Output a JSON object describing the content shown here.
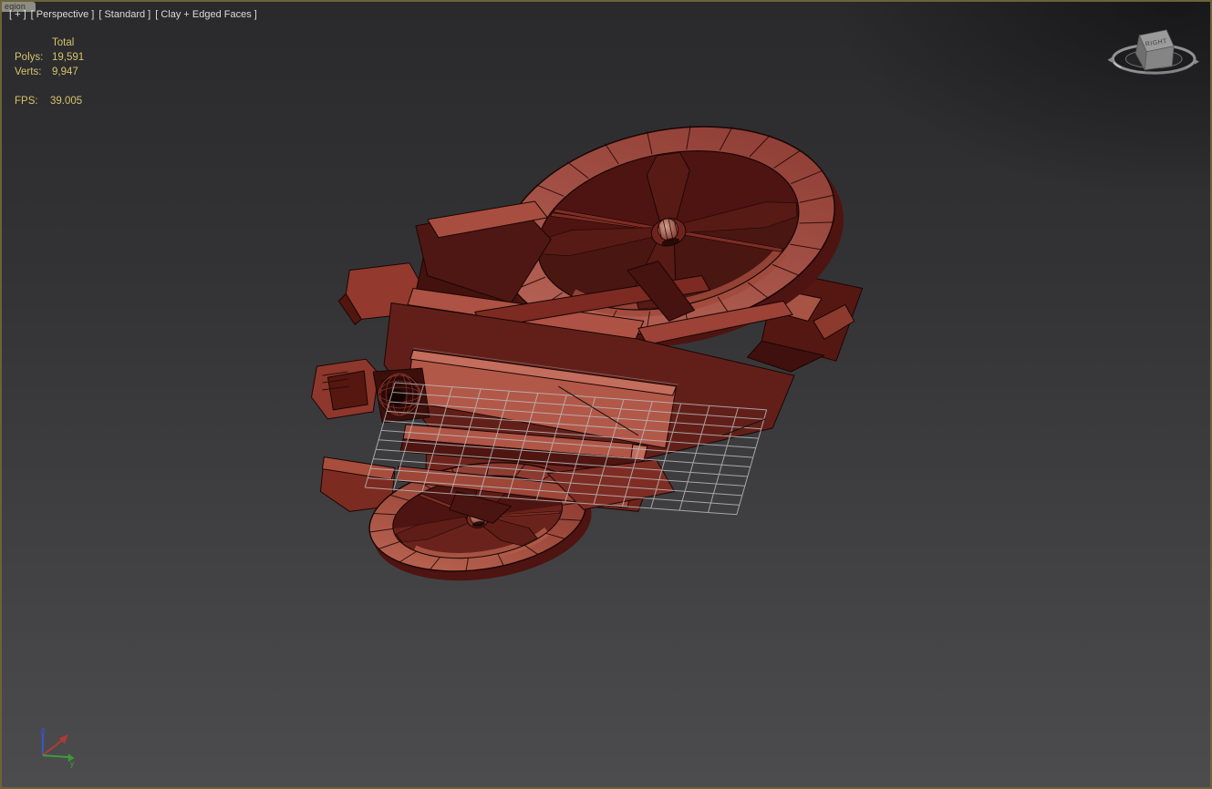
{
  "viewport": {
    "selection_tab_label": "egion",
    "label_menus": {
      "general": "[ + ]",
      "point_of_view": "[ Perspective ]",
      "render_preset": "[ Standard ]",
      "shading": "[ Clay + Edged Faces ]"
    },
    "statistics": {
      "total_header": "Total",
      "polys_label": "Polys:",
      "polys_value": "19,591",
      "verts_label": "Verts:",
      "verts_value": "9,947",
      "fps_label": "FPS:",
      "fps_value": "39.005"
    },
    "viewcube": {
      "face_label": "RIGHT"
    },
    "axis_gizmo": {
      "z_label": "z",
      "y_label": "y"
    }
  },
  "colors": {
    "viewport_bg_top": "#2a2a2c",
    "viewport_bg_bottom": "#4c4c4e",
    "active_border": "#6b6339",
    "stats_text": "#d5c36c",
    "label_text": "#dcdcdc",
    "model_dark": "#4e1713",
    "model_mid": "#8a332b",
    "model_light": "#b25848",
    "model_lighter": "#c36d5c",
    "edge_black": "#1a0604",
    "wire_grid": "#b9b9bb",
    "axis_x": "#b03a34",
    "axis_y": "#3f9b3a",
    "axis_z": "#3b55c8",
    "viewcube_face": "#9b9b9b"
  }
}
